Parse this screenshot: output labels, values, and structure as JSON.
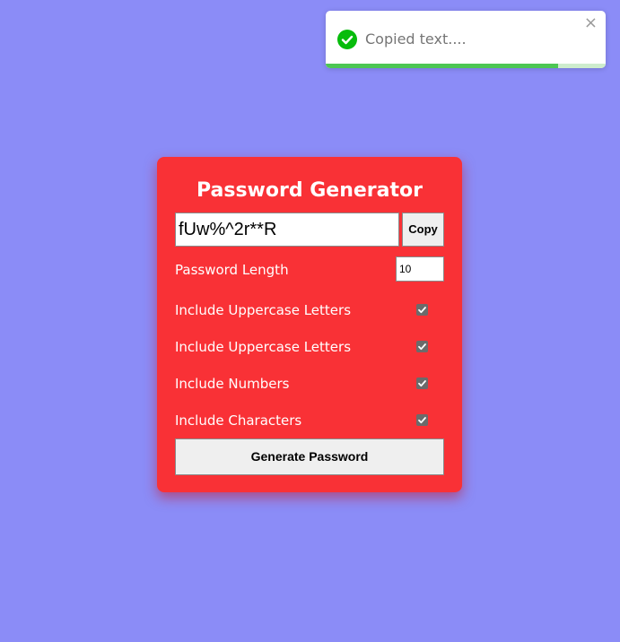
{
  "toast": {
    "message": "Copied text....",
    "close_glyph": "×",
    "icon": "check-circle-icon",
    "progress_fraction": 0.83,
    "accent_color": "#07bc0c"
  },
  "generator": {
    "title": "Password Generator",
    "password_value": "fUw%^2r**R",
    "copy_label": "Copy",
    "length_label": "Password Length",
    "length_value": "10",
    "options": [
      {
        "label": "Include Uppercase Letters",
        "checked": true
      },
      {
        "label": "Include Uppercase Letters",
        "checked": true
      },
      {
        "label": "Include Numbers",
        "checked": true
      },
      {
        "label": "Include Characters",
        "checked": true
      }
    ],
    "generate_label": "Generate Password",
    "card_color": "#f93136"
  },
  "page": {
    "background_color": "#8b8cf7"
  }
}
